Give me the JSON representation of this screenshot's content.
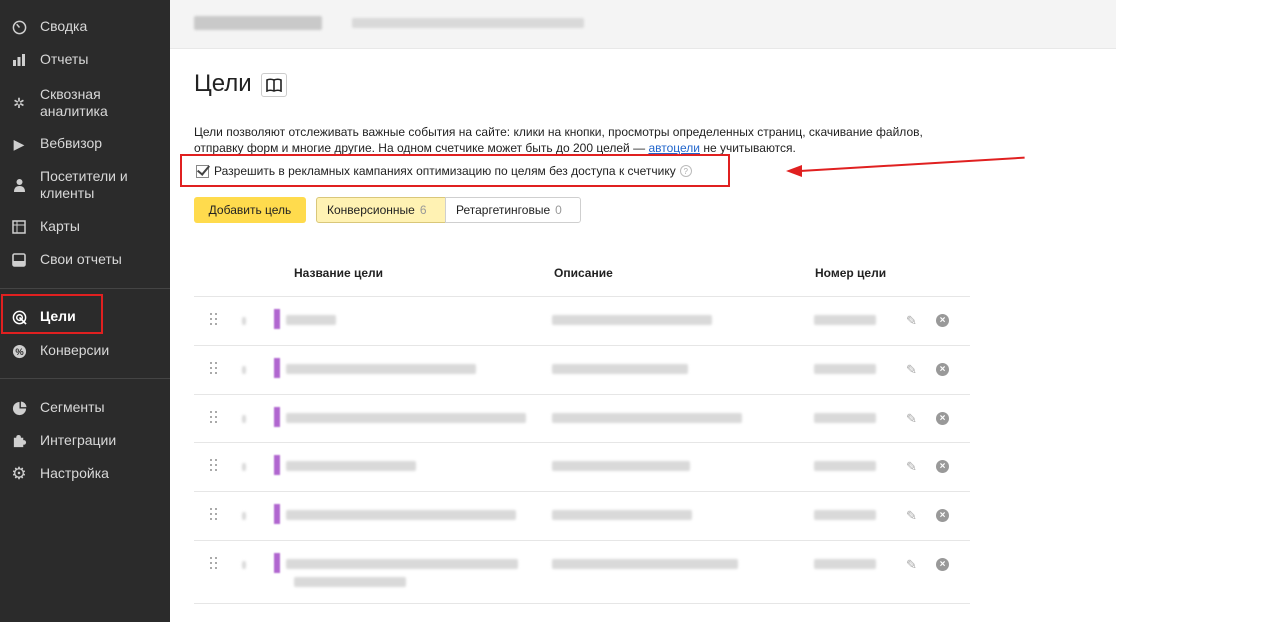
{
  "sidebar": {
    "items": [
      {
        "label": "Сводка",
        "icon": "gauge-icon"
      },
      {
        "label": "Отчеты",
        "icon": "bar-chart-icon"
      },
      {
        "label": "Сквозная аналитика",
        "icon": "snowflake-icon"
      },
      {
        "label": "Вебвизор",
        "icon": "play-icon"
      },
      {
        "label": "Посетители и клиенты",
        "icon": "person-icon"
      },
      {
        "label": "Карты",
        "icon": "map-grid-icon"
      },
      {
        "label": "Свои отчеты",
        "icon": "inbox-icon"
      },
      {
        "label": "Цели",
        "icon": "target-icon"
      },
      {
        "label": "Конверсии",
        "icon": "percent-icon"
      },
      {
        "label": "Сегменты",
        "icon": "pie-icon"
      },
      {
        "label": "Интеграции",
        "icon": "puzzle-icon"
      },
      {
        "label": "Настройка",
        "icon": "gear-icon"
      }
    ]
  },
  "page": {
    "title": "Цели",
    "description_part1": "Цели позволяют отслеживать важные события на сайте: клики на кнопки, просмотры определенных страниц, скачивание файлов, отправку форм и многие другие. На одном счетчике может быть до 200 целей — ",
    "description_link": "автоцели",
    "description_part2": " не учитываются.",
    "option_label": "Разрешить в рекламных кампаниях оптимизацию по целям без доступа к счетчику",
    "option_checked": true
  },
  "toolbar": {
    "add_label": "Добавить цель",
    "tabs": [
      {
        "label": "Конверсионные",
        "count": "6"
      },
      {
        "label": "Ретаргетинговые",
        "count": "0"
      }
    ]
  },
  "table": {
    "headers": {
      "name": "Название цели",
      "description": "Описание",
      "number": "Номер цели"
    }
  },
  "colors": {
    "sidebar_bg": "#2b2b2b",
    "accent_button": "#ffdb4d",
    "highlight": "#e02020",
    "link": "#2266cc"
  }
}
